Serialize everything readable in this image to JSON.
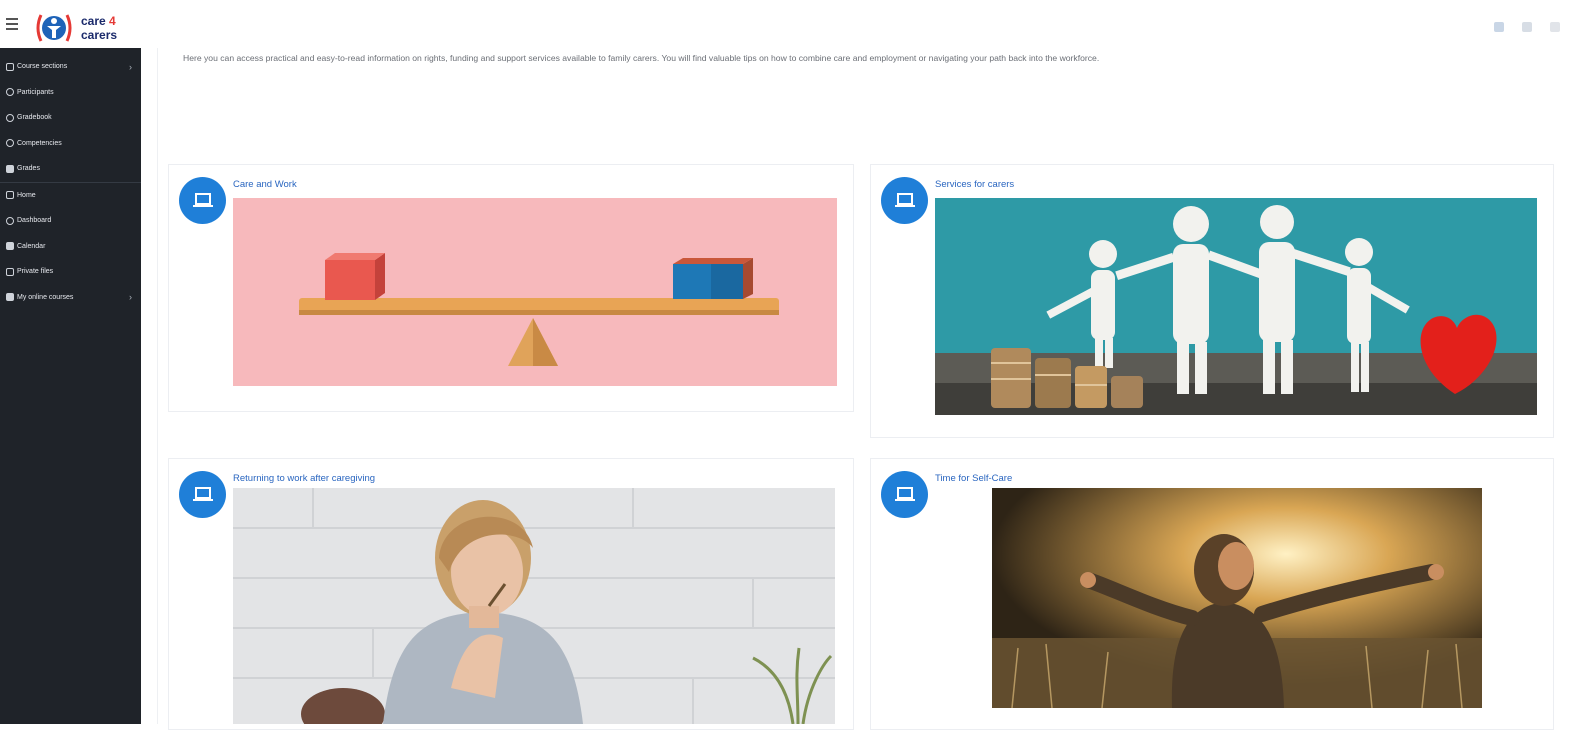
{
  "brand": {
    "line1": "care",
    "four": "4",
    "line2": "carers"
  },
  "sidebar": {
    "items": [
      {
        "label": "Course sections",
        "icon": "list-icon",
        "has_chevron": true
      },
      {
        "label": "Participants",
        "icon": "users-icon",
        "has_chevron": false
      },
      {
        "label": "Gradebook",
        "icon": "grade-icon",
        "has_chevron": false
      },
      {
        "label": "Competencies",
        "icon": "check-icon",
        "has_chevron": false
      },
      {
        "label": "Grades",
        "icon": "table-icon",
        "has_chevron": false
      },
      {
        "label": "Home",
        "icon": "home-icon",
        "has_chevron": false
      },
      {
        "label": "Dashboard",
        "icon": "dashboard-icon",
        "has_chevron": false
      },
      {
        "label": "Calendar",
        "icon": "calendar-icon",
        "has_chevron": false
      },
      {
        "label": "Private files",
        "icon": "file-icon",
        "has_chevron": false
      },
      {
        "label": "My online courses",
        "icon": "courses-icon",
        "has_chevron": true
      }
    ]
  },
  "main": {
    "intro": "Here you can access practical and easy-to-read information on rights, funding and support services available to family carers. You will find valuable tips on how to combine care and employment or navigating your path back into the workforce.",
    "cards": [
      {
        "title": "Care and Work",
        "image": "seesaw-balance-image"
      },
      {
        "title": "Services for carers",
        "image": "family-coins-heart-image"
      },
      {
        "title": "Returning to work after caregiving",
        "image": "woman-thinking-image"
      },
      {
        "title": "Time for Self-Care",
        "image": "woman-sunlight-image"
      }
    ]
  },
  "colors": {
    "sidebar": "#1f2329",
    "accent": "#1f7fd8",
    "title": "#2a66c0",
    "brand_red": "#e53935",
    "brand_navy": "#1b2a6b"
  }
}
